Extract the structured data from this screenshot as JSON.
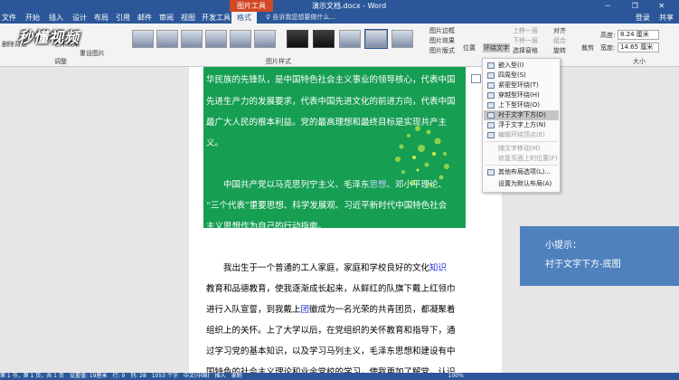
{
  "window": {
    "context_tab_group": "图片工具",
    "doc_title": "演示文档.docx - Word",
    "window_buttons": "－ ❐ ✕"
  },
  "tabs": [
    "文件",
    "开始",
    "插入",
    "设计",
    "布局",
    "引用",
    "邮件",
    "审阅",
    "视图",
    "开发工具",
    "格式"
  ],
  "active_tab": "格式",
  "search_placeholder": "♀ 告诉我您想要做什么...",
  "user": {
    "login": "登录",
    "share": "共享"
  },
  "watermark_logo": "秒懂视频",
  "ribbon": {
    "adjust_group_label": "调整",
    "adjust_items": [
      "删除背景",
      "艺术效果",
      "重设图片"
    ],
    "picture_styles_label": "图片样式",
    "picture_style_options": [
      "图片边框",
      "图片效果",
      "图片版式"
    ],
    "arrange_items": [
      "位置",
      "环绕文字",
      "上移一层",
      "下移一层",
      "选择窗格",
      "对齐",
      "组合",
      "旋转"
    ],
    "crop_label": "裁剪",
    "size_group_label": "大小",
    "height_label": "高度:",
    "height_value": "8.24 厘米",
    "width_label": "宽度:",
    "width_value": "14.65 厘米"
  },
  "wrap_menu": {
    "items": [
      {
        "label": "嵌入型(I)",
        "enabled": true,
        "highlighted": false
      },
      {
        "label": "四周型(S)",
        "enabled": true,
        "highlighted": false
      },
      {
        "label": "紧密型环绕(T)",
        "enabled": true,
        "highlighted": false
      },
      {
        "label": "穿越型环绕(H)",
        "enabled": true,
        "highlighted": false
      },
      {
        "label": "上下型环绕(O)",
        "enabled": true,
        "highlighted": false
      },
      {
        "label": "衬于文字下方(D)",
        "enabled": true,
        "highlighted": true
      },
      {
        "label": "浮于文字上方(N)",
        "enabled": true,
        "highlighted": false
      },
      {
        "label": "编辑环绕顶点(E)",
        "enabled": false,
        "highlighted": false
      },
      {
        "label": "随文字移动(M)",
        "enabled": false,
        "highlighted": false
      },
      {
        "label": "修复页面上的位置(F)",
        "enabled": false,
        "highlighted": false
      },
      {
        "label": "其他布局选项(L)...",
        "enabled": true,
        "highlighted": false
      },
      {
        "label": "设置为默认布局(A)",
        "enabled": true,
        "highlighted": false
      }
    ]
  },
  "document": {
    "lines_selected": [
      "华民族的先锋队，是中国特色社会主义事业的领导核心，代表中国",
      "先进生产力的发展要求，代表中国先进文化的前进方向，代表中国",
      "最广大人民的根本利益。党的最高理想和最终目标是实现共产主",
      "义。"
    ],
    "para2": [
      {
        "pre": "　　中国共产党以马克思列宁主义、毛泽东",
        "hl": "思想",
        "post": "、邓小平理论、"
      },
      {
        "pre": "“三个代表”重要思想、科学发展观、习近平新时代中国特色社会",
        "hl": "",
        "post": ""
      },
      {
        "pre": "主义思想作为自己的行动指南。",
        "hl": "",
        "post": ""
      }
    ],
    "para3": [
      {
        "pre": "　　我出生于一个普通的工人家庭，家庭和学校良好的文化",
        "hl": "知识",
        "post": ""
      },
      {
        "pre": "教育和品德教育，使我逐渐成长起来，从鲜红的队旗下戴上红领巾",
        "hl": "",
        "post": ""
      },
      {
        "pre": "进行入队宣誓，到我戴上",
        "hl": "团",
        "post": "徽成为一名光荣的共青团员，都凝聚着"
      },
      {
        "pre": "组织上的关怀。上了大学以后，在党组织的关怀教育和指导下，通",
        "hl": "",
        "post": ""
      },
      {
        "pre": "过学习党的基本知识，以及学习马列主义，毛泽东思想和建设有中",
        "hl": "",
        "post": ""
      },
      {
        "pre": "国特色的社会主义理论和业余党校的学习，使我更加了解党，认识",
        "hl": "",
        "post": ""
      }
    ]
  },
  "tip": {
    "title": "小提示：",
    "body": "衬于文字下方-底图"
  },
  "statusbar": "第 1 节，第 1 页，共 1 页　设置值: 19厘米　行: 9　列: 28　1053 个字　中文(中国)　插入　录制　　　　　　　　　　　　　　　　　　　　　　　　　　　　　　　　　　　　　　100%",
  "colors": {
    "word_blue": "#2b579a",
    "picture_green": "#169e52",
    "tip_blue": "#4f81bd",
    "context_tab": "#d24726"
  }
}
